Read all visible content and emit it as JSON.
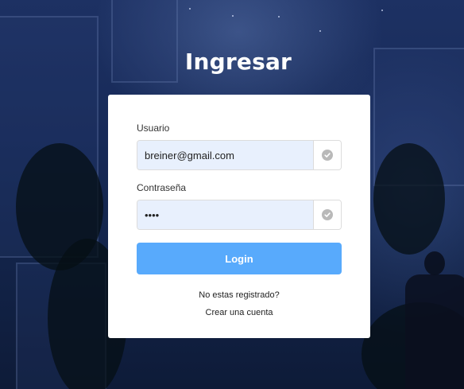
{
  "page": {
    "title": "Ingresar"
  },
  "form": {
    "username": {
      "label": "Usuario",
      "value": "breiner@gmail.com"
    },
    "password": {
      "label": "Contraseña",
      "value": "1234"
    },
    "login_label": "Login",
    "not_registered_text": "No estas registrado?",
    "create_account_label": "Crear una cuenta"
  },
  "colors": {
    "accent": "#58aafc",
    "input_background": "#e8f0fd",
    "card": "#ffffff"
  },
  "icons": {
    "field_valid": "check-circle-icon"
  }
}
